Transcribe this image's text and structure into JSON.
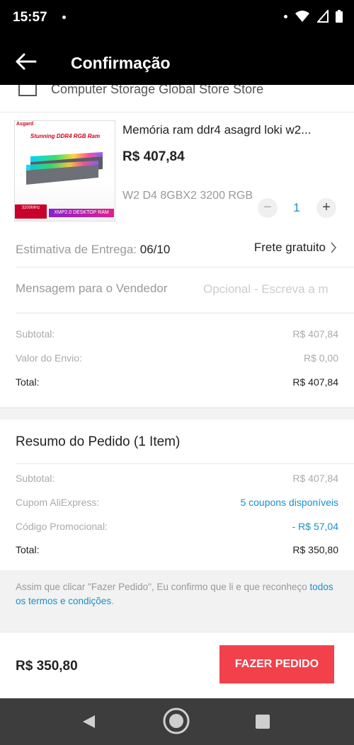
{
  "status": {
    "time": "15:57"
  },
  "header": {
    "title": "Confirmação"
  },
  "store": {
    "name": "Computer Storage Global Store Store"
  },
  "product": {
    "image_banner": "Stunning DDR4 RGB  Ram",
    "image_brand": "Asgard",
    "image_tag": "3200MHz",
    "image_bottom": "XMP2.0 DESKTOP RAM",
    "title": "Memória ram ddr4 asagrd loki w2...",
    "price": "R$ 407,84",
    "variant": "W2 D4 8GBX2 3200 RGB",
    "quantity": "1",
    "qty_minus": "−",
    "qty_plus": "+"
  },
  "delivery": {
    "label": "Estimativa de Entrega: ",
    "date": "06/10",
    "shipping": "Frete gratuito"
  },
  "message": {
    "label": "Mensagem para o Vendedor",
    "placeholder": "Opcional - Escreva a m"
  },
  "store_summary": [
    {
      "label": "Subtotal:",
      "value": "R$ 407,84"
    },
    {
      "label": "Valor do Envio:",
      "value": "R$ 0,00"
    },
    {
      "label": "Total:",
      "value": "R$ 407,84"
    }
  ],
  "order_summary": {
    "title": "Resumo do Pedido (1 Item)",
    "rows": [
      {
        "label": "Subtotal:",
        "value": "R$ 407,84"
      },
      {
        "label": "Cupom AliExpress:",
        "value": "5 coupons disponíveis"
      },
      {
        "label": "Código Promocional:",
        "value": "- R$ 57,04"
      },
      {
        "label": "Total:",
        "value": "R$ 350,80"
      }
    ]
  },
  "terms": {
    "text": "Assim que clicar \"Fazer Pedido\", Eu confirmo que li e que reconheço ",
    "link": "todos os termos e condições",
    "end": "."
  },
  "footer": {
    "total": "R$ 350,80",
    "button": "FAZER PEDIDO"
  },
  "colors": {
    "accent": "#f2414a",
    "link": "#1a8fcf"
  }
}
